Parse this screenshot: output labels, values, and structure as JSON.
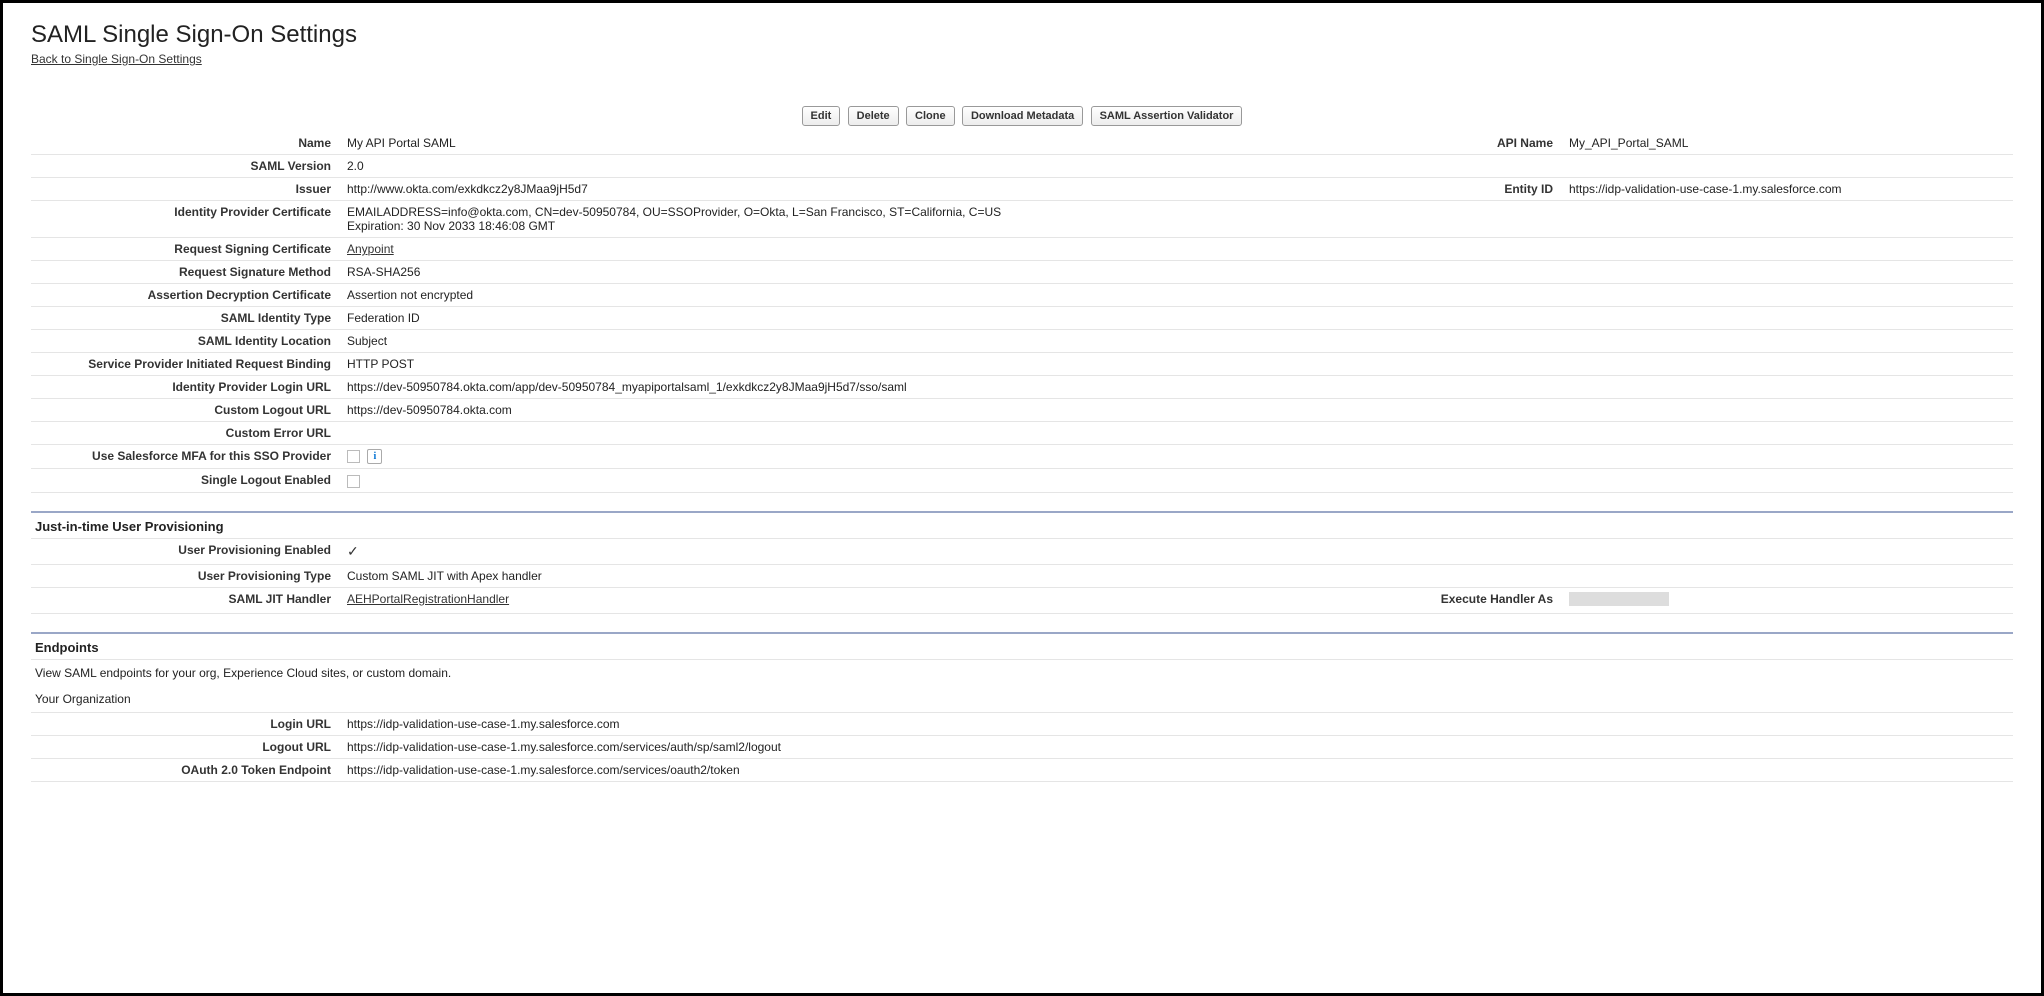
{
  "header": {
    "title": "SAML Single Sign-On Settings",
    "back_link": "Back to Single Sign-On Settings"
  },
  "buttons": {
    "edit": "Edit",
    "delete": "Delete",
    "clone": "Clone",
    "download_metadata": "Download Metadata",
    "validator": "SAML Assertion Validator"
  },
  "labels": {
    "name": "Name",
    "api_name": "API Name",
    "saml_version": "SAML Version",
    "issuer": "Issuer",
    "entity_id": "Entity ID",
    "idp_cert": "Identity Provider Certificate",
    "req_sign_cert": "Request Signing Certificate",
    "req_sig_method": "Request Signature Method",
    "assert_decrypt_cert": "Assertion Decryption Certificate",
    "saml_identity_type": "SAML Identity Type",
    "saml_identity_location": "SAML Identity Location",
    "sp_binding": "Service Provider Initiated Request Binding",
    "idp_login_url": "Identity Provider Login URL",
    "custom_logout_url": "Custom Logout URL",
    "custom_error_url": "Custom Error URL",
    "use_mfa": "Use Salesforce MFA for this SSO Provider",
    "slo_enabled": "Single Logout Enabled",
    "user_prov_enabled": "User Provisioning Enabled",
    "user_prov_type": "User Provisioning Type",
    "saml_jit_handler": "SAML JIT Handler",
    "execute_handler_as": "Execute Handler As",
    "login_url": "Login URL",
    "logout_url": "Logout URL",
    "oauth_token_endpoint": "OAuth 2.0 Token Endpoint"
  },
  "values": {
    "name": "My API Portal SAML",
    "api_name": "My_API_Portal_SAML",
    "saml_version": "2.0",
    "issuer": "http://www.okta.com/exkdkcz2y8JMaa9jH5d7",
    "entity_id": "https://idp-validation-use-case-1.my.salesforce.com",
    "idp_cert_line1": "EMAILADDRESS=info@okta.com, CN=dev-50950784, OU=SSOProvider, O=Okta, L=San Francisco, ST=California, C=US",
    "idp_cert_line2": "Expiration: 30 Nov 2033 18:46:08 GMT",
    "req_sign_cert": "Anypoint",
    "req_sig_method": "RSA-SHA256",
    "assert_decrypt_cert": "Assertion not encrypted",
    "saml_identity_type": "Federation ID",
    "saml_identity_location": "Subject",
    "sp_binding": "HTTP POST",
    "idp_login_url": "https://dev-50950784.okta.com/app/dev-50950784_myapiportalsaml_1/exkdkcz2y8JMaa9jH5d7/sso/saml",
    "custom_logout_url": "https://dev-50950784.okta.com",
    "custom_error_url": "",
    "user_prov_type": "Custom SAML JIT with Apex handler",
    "saml_jit_handler": "AEHPortalRegistrationHandler",
    "login_url": "https://idp-validation-use-case-1.my.salesforce.com",
    "logout_url": "https://idp-validation-use-case-1.my.salesforce.com/services/auth/sp/saml2/logout",
    "oauth_token_endpoint": "https://idp-validation-use-case-1.my.salesforce.com/services/oauth2/token"
  },
  "sections": {
    "jit_title": "Just-in-time User Provisioning",
    "endpoints_title": "Endpoints",
    "endpoints_desc": "View SAML endpoints for your org, Experience Cloud sites, or custom domain.",
    "your_org": "Your Organization"
  }
}
